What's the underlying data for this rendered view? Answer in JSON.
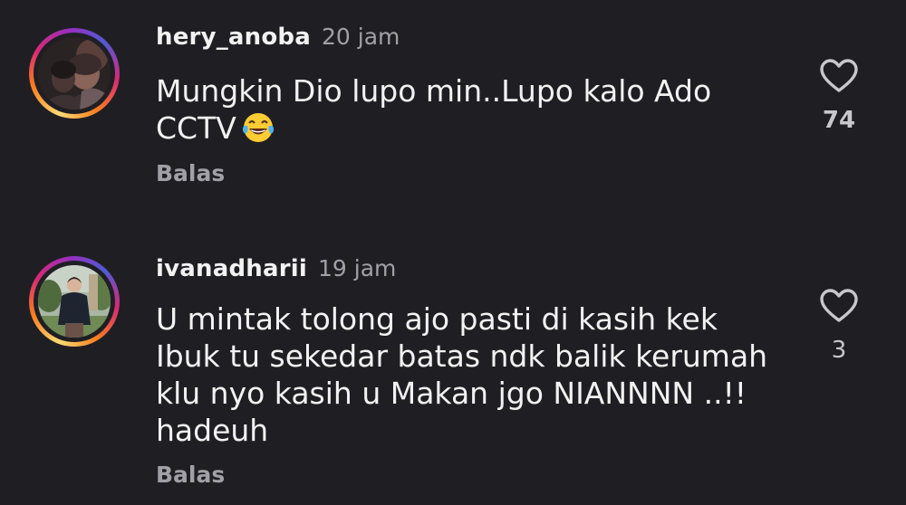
{
  "comments": [
    {
      "username": "hery_anoba",
      "time": "20 jam",
      "text_lines": [
        "Mungkin Dio lupo min..Lupo kalo Ado",
        "CCTV"
      ],
      "emoji": "face-with-tears-of-joy",
      "reply_label": "Balas",
      "like_count": "74",
      "liked": false
    },
    {
      "username": "ivanadharii",
      "time": "19 jam",
      "text_lines": [
        "U mintak tolong ajo pasti di kasih kek",
        "Ibuk tu sekedar batas ndk balik kerumah",
        "klu nyo kasih u Makan jgo NIANNNN ..!!",
        "hadeuh"
      ],
      "reply_label": "Balas",
      "like_count": "3",
      "liked": false
    }
  ],
  "colors": {
    "background": "#1f1f23",
    "primary_text": "#f2f2f2",
    "secondary_text": "#a0a0a6",
    "story_ring": [
      "#feda75",
      "#fa7e1e",
      "#d62976",
      "#962fbf"
    ]
  },
  "icons": {
    "like": "heart-outline-icon"
  }
}
